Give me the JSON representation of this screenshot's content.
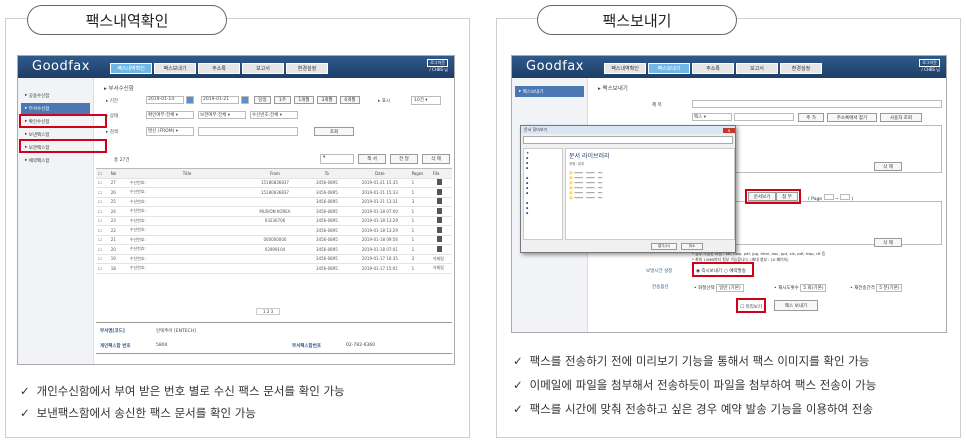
{
  "left_panel": {
    "title": "팩스내역확인",
    "app": {
      "logo": "Goodfax",
      "tabs": [
        "팩스내역확인",
        "팩스보내기",
        "주소록",
        "보고서",
        "환경설정"
      ],
      "top_links": [
        "로그아웃",
        "/ CHBS 님"
      ],
      "sidebar": [
        "공용수신함",
        "부서수신함",
        "확인수신함",
        "보낸팩스함",
        "보관팩스함",
        "예약팩스함"
      ],
      "section_title": "부서수신함",
      "filters": {
        "period_label": "기간",
        "date_from": "2019-01-14",
        "date_to": "2019-01-21",
        "quick": [
          "당일",
          "1주",
          "1개월",
          "3개월",
          "6개월"
        ],
        "display_label": "표시",
        "display_value": "10건",
        "status_label": "상태",
        "status1": "확인여부:전체",
        "status2": "보관여부:전체",
        "status3": "수신번호:전체",
        "search_label": "검색",
        "search_select": "발신 (FROM)",
        "search_button": "조회"
      },
      "count": "총 27건",
      "actions": [
        "책 서",
        "전 달",
        "삭 제"
      ],
      "columns": [
        "No",
        "Title",
        "From",
        "To",
        "Date",
        "Pages",
        "File"
      ],
      "rows": [
        [
          "27",
          "수신번호:",
          "15180836837",
          "3456-0895",
          "2019-01-21 15:35",
          "1",
          ""
        ],
        [
          "26",
          "수신번호:",
          "15180836837",
          "3456-0895",
          "2019-01-21 15:33",
          "1",
          ""
        ],
        [
          "25",
          "수신번호:",
          "",
          "3456-0895",
          "2019-01-21 13:31",
          "3",
          ""
        ],
        [
          "24",
          "수신번호:",
          "MUSION KOREA",
          "3456-0895",
          "2019-01-18 07:00",
          "1",
          ""
        ],
        [
          "23",
          "수신번호:",
          "03236706",
          "3456-0895",
          "2019-01-18 13:29",
          "1",
          ""
        ],
        [
          "22",
          "수신번호:",
          "",
          "3456-0895",
          "2019-01-18 13:29",
          "1",
          ""
        ],
        [
          "21",
          "수신번호:",
          "000000000",
          "3456-0895",
          "2019-01-18 09:56",
          "1",
          ""
        ],
        [
          "20",
          "수신번호:",
          "02999104",
          "3456-0895",
          "2019-01-18 07:01",
          "1",
          ""
        ],
        [
          "19",
          "수신번호:",
          "",
          "3456-0895",
          "2019-01-17 16:35",
          "3",
          "삭제됨"
        ],
        [
          "18",
          "수신번호:",
          "",
          "3456-0895",
          "2019-01-17 15:01",
          "1",
          "삭제됨"
        ]
      ],
      "pager": "1 2 3",
      "footer": {
        "dept_code_label": "부서명[코드]",
        "dept_code_value": "인텍추어 [ENTECH]",
        "personal_label": "개인팩스함 번호",
        "personal_value": "5804",
        "dept_fax_label": "부서팩스함번호",
        "dept_fax_value": "02-782-6360"
      }
    },
    "bullets": [
      "개인수신함에서 부여 받은 번호 별로 수신 팩스 문서를 확인 가능",
      "보낸팩스함에서 송신한 팩스 문서를 확인 가능"
    ]
  },
  "right_panel": {
    "title": "팩스보내기",
    "app": {
      "logo": "Goodfax",
      "tabs": [
        "팩스내역확인",
        "팩스보내기",
        "주소록",
        "보고서",
        "환경설정"
      ],
      "top_links": [
        "로그아웃",
        "/ CHBS 님"
      ],
      "sidebar": [
        "팩스보내기"
      ],
      "section_title": "팩스보내기",
      "form": {
        "title_label": "제 목",
        "recipient_select": "팩스",
        "add_btn": "추 가",
        "addr_btn": "주소록에서 찾기",
        "user_btn": "사용자 조회",
        "delete_btn": "삭 제",
        "delete_btn2": "삭 제",
        "preview_btn": "문서보기",
        "attach_btn": "첨 부",
        "page_label": "( Page",
        "page_sep": "~",
        "page_end": ")",
        "note1": "* 첨부 가능한 파일 : txt, hwp, pdf, jpg, html, doc, ppt, xls, pdf, hwp, rtf 등",
        "note2": "* 최대 10MB까지 첨부 가능합니다. (최대 첨부 : 10 페이지)",
        "send_time_label": "보낼시간 설정",
        "send_now": "즉시보내기",
        "send_reserve": "예약발송",
        "options_label": "전송옵션",
        "opt1_label": "화질선택",
        "opt1_value": "일반 (기본)",
        "opt2_label": "재시도횟수",
        "opt2_value": "5 회(기본)",
        "opt3_label": "재전송간격",
        "opt3_value": "5 분(기본)",
        "preview_check": "미리보기",
        "send_btn": "팩스 보내기"
      },
      "dialog": {
        "title": "문서 찾아보기",
        "folder": "문서 라이브러리",
        "folder_sub": "포함: 위치",
        "open_btn": "열기(O)",
        "cancel_btn": "취소"
      }
    },
    "bullets": [
      "팩스를 전송하기 전에 미리보기 기능을 통해서 팩스 이미지를 확인 가능",
      "이메일에 파일을 첨부해서 전송하듯이 파일을 첨부하여 팩스 전송이 가능",
      "팩스를 시간에 맞춰 전송하고 싶은 경우 예약 발송 기능을 이용하여 전송"
    ]
  }
}
